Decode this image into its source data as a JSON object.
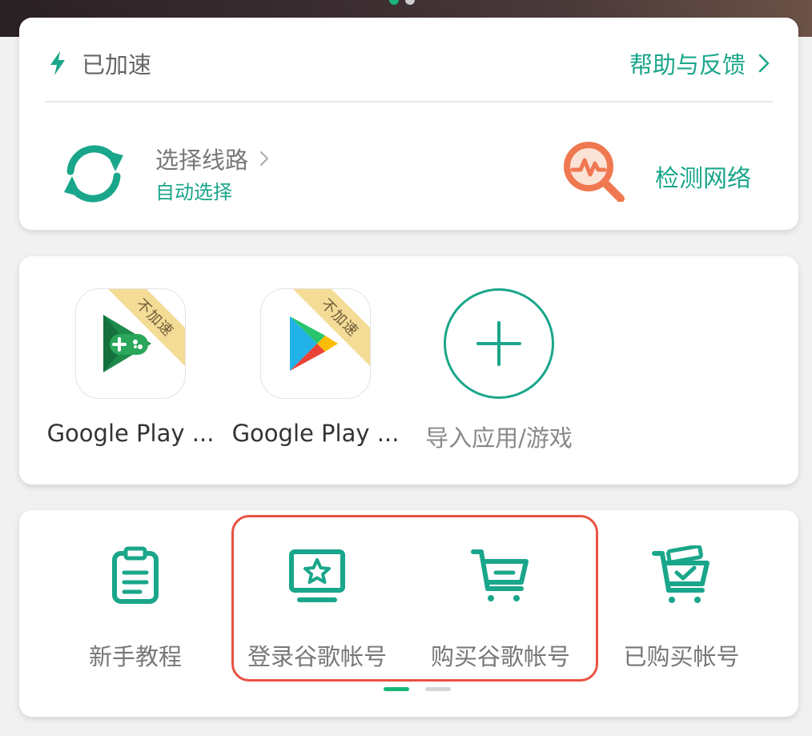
{
  "colors": {
    "accent": "#1aa68a",
    "highlight": "#e85243",
    "ribbon": "#f5dc96",
    "network_icon": "#f07850"
  },
  "status": {
    "text": "已加速",
    "icon": "lightning-bolt-icon",
    "help_label": "帮助与反馈"
  },
  "route": {
    "title": "选择线路",
    "subtitle": "自动选择",
    "icon": "refresh-icon"
  },
  "network": {
    "label": "检测网络",
    "icon": "network-check-icon"
  },
  "apps": [
    {
      "label": "Google Play ...",
      "badge": "不加速",
      "icon": "google-play-games-icon"
    },
    {
      "label": "Google Play ...",
      "badge": "不加速",
      "icon": "google-play-store-icon"
    },
    {
      "label": "导入应用/游戏",
      "icon": "add-icon"
    }
  ],
  "shortcuts": [
    {
      "label": "新手教程",
      "icon": "clipboard-icon"
    },
    {
      "label": "登录谷歌帐号",
      "icon": "monitor-star-icon"
    },
    {
      "label": "购买谷歌帐号",
      "icon": "shopping-cart-icon"
    },
    {
      "label": "已购买帐号",
      "icon": "cart-check-icon"
    }
  ],
  "pagination": {
    "current": 1,
    "total": 2
  }
}
